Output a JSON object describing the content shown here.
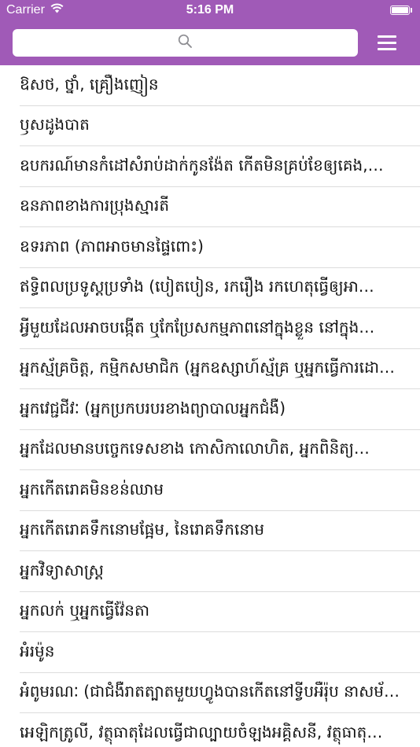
{
  "status_bar": {
    "carrier": "Carrier",
    "time": "5:16 PM",
    "battery_level": 1.0
  },
  "nav": {
    "background_color": "#a05ab7",
    "search_placeholder": "",
    "search_icon": "magnifier-icon",
    "menu_icon": "hamburger-menu-icon"
  },
  "entries": [
    "ឱសថ, ថ្នាំ, គ្រឿងញៀន",
    "ឫសដូងបាត",
    "ឧបករណ៍មានកំដៅសំរាប់ដាក់កូនង៉ែត កើតមិនគ្រប់ខែឲ្យគេង,…",
    "ឧនភាពខាងការប្រុងស្មារតី",
    "ឧទរភាព (ភាពអាចមានផ្ទៃពោះ)",
    "ឥទ្ធិពលប្រទូស្តប្រទាំង (បៀតបៀន, រករឿង រកហេតុធ្វើឲ្យអា…",
    "អ្វីមួយដែលអាចបង្កើត ឬកែប្រែសកម្មភាពនៅក្នុងខ្លួន នៅក្នុង…",
    "អ្នកស្ម័គ្រចិត្ត, កម្មិកសមាជិក (អ្នកឧស្សាហ៍ស្ម័គ្រ ឬអ្នកធ្វើការដោ…",
    "អ្នកវេជ្ជជីវៈ (អ្នកប្រកបរបរខាងព្យាបាលអ្នកជំងឺ)",
    "អ្នកដែលមានបច្ចេកទេសខាង កោសិកាលោហិត, អ្នកពិនិត្យ…",
    "អ្នកកើតរោគមិនខន់ឈាម",
    "អ្នកកើតរោគទឹកនោមផ្អែម, នៃរោគទឹកនោម",
    "អ្នកវិទ្យាសាស្ត្រ",
    "អ្នកលក់ ឬអ្នកធ្វើវ៉ែនតា",
    "អំរម៉ូន",
    "អំពូមរណៈ (ជាជំងឺរាតត្បាតមួយហ្វូងបានកើតនៅទ្វីបអឺរ៉ុប នាសម័យ…",
    "អេឡិកត្រូលី, វត្ថុធាតុដែលធ្វើជាល្បាយចំឡងអគ្គិសនី, វត្ថុធាតុ…"
  ]
}
